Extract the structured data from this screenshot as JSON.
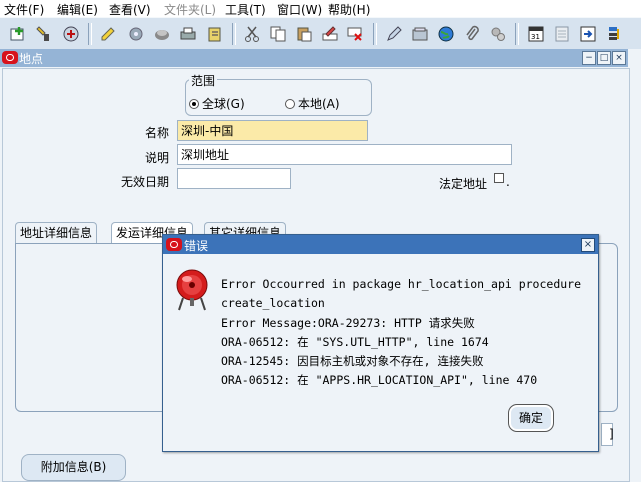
{
  "menu": [
    {
      "label": "文件(F)",
      "disabled": false
    },
    {
      "label": "编辑(E)",
      "disabled": false
    },
    {
      "label": "查看(V)",
      "disabled": false
    },
    {
      "label": "文件夹(L)",
      "disabled": true
    },
    {
      "label": "工具(T)",
      "disabled": false
    },
    {
      "label": "窗口(W)",
      "disabled": false
    },
    {
      "label": "帮助(H)",
      "disabled": false
    }
  ],
  "toolbar_icons": [
    "new-icon",
    "find-icon",
    "navigate-icon",
    "zoom-icon",
    "attach-icon",
    "print-icon",
    "save-icon",
    "cut-icon",
    "copy-icon",
    "paste-icon",
    "clear-field-icon",
    "delete-record-icon",
    "edit-icon",
    "folder-icon",
    "globe-icon",
    "paperclip-icon",
    "tools-icon",
    "calendar-icon",
    "notes-icon",
    "export-icon",
    "tree-icon"
  ],
  "window": {
    "title": "地点"
  },
  "scope": {
    "label": "范围",
    "options": [
      {
        "label": "全球(G)",
        "selected": true
      },
      {
        "label": "本地(A)",
        "selected": false
      }
    ]
  },
  "fields": {
    "name_label": "名称",
    "name_value": "深圳-中国",
    "desc_label": "说明",
    "desc_value": "深圳地址",
    "inactive_label": "无效日期",
    "inactive_value": "",
    "legal_label": "法定地址",
    "legal_checked": false
  },
  "tabs": [
    {
      "label": "地址详细信息",
      "active": false
    },
    {
      "label": "发运详细信息",
      "active": true
    },
    {
      "label": "其它详细信息",
      "active": false
    }
  ],
  "addl_button": "附加信息(B)",
  "stub_text": "]",
  "legal_dot": ".",
  "dialog": {
    "title": "错误",
    "lines": [
      "Error Occourred in package hr_location_api procedure",
      "create_location",
      "Error Message:ORA-29273: HTTP 请求失败",
      "ORA-06512: 在 \"SYS.UTL_HTTP\", line 1674",
      "ORA-12545: 因目标主机或对象不存在, 连接失败",
      "ORA-06512: 在 \"APPS.HR_LOCATION_API\", line 470"
    ],
    "ok": "确定"
  },
  "colors": {
    "accent": "#3c73b9",
    "window_title": "#95b4d6",
    "required_field": "#fbeaa8",
    "background": "#eef3f8"
  }
}
